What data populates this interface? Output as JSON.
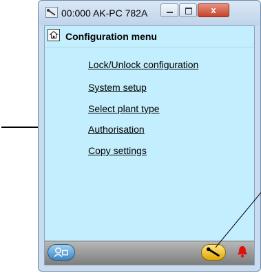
{
  "window": {
    "title": "00:000 AK-PC 782A",
    "controls": {
      "close_label": "x"
    }
  },
  "menu": {
    "title": "Configuration menu",
    "items": [
      {
        "label": "Lock/Unlock configuration"
      },
      {
        "label": "System setup"
      },
      {
        "label": "Select plant type"
      },
      {
        "label": "Authorisation"
      },
      {
        "label": "Copy settings"
      }
    ]
  },
  "icons": {
    "app": "probe-icon",
    "home": "home-icon",
    "user": "user-login-icon",
    "service": "wrench-icon",
    "alarm": "alarm-bell-icon"
  },
  "colors": {
    "client_background": "#c2eefd",
    "close_button": "#c8432b",
    "alarm_bell": "#e01010"
  }
}
